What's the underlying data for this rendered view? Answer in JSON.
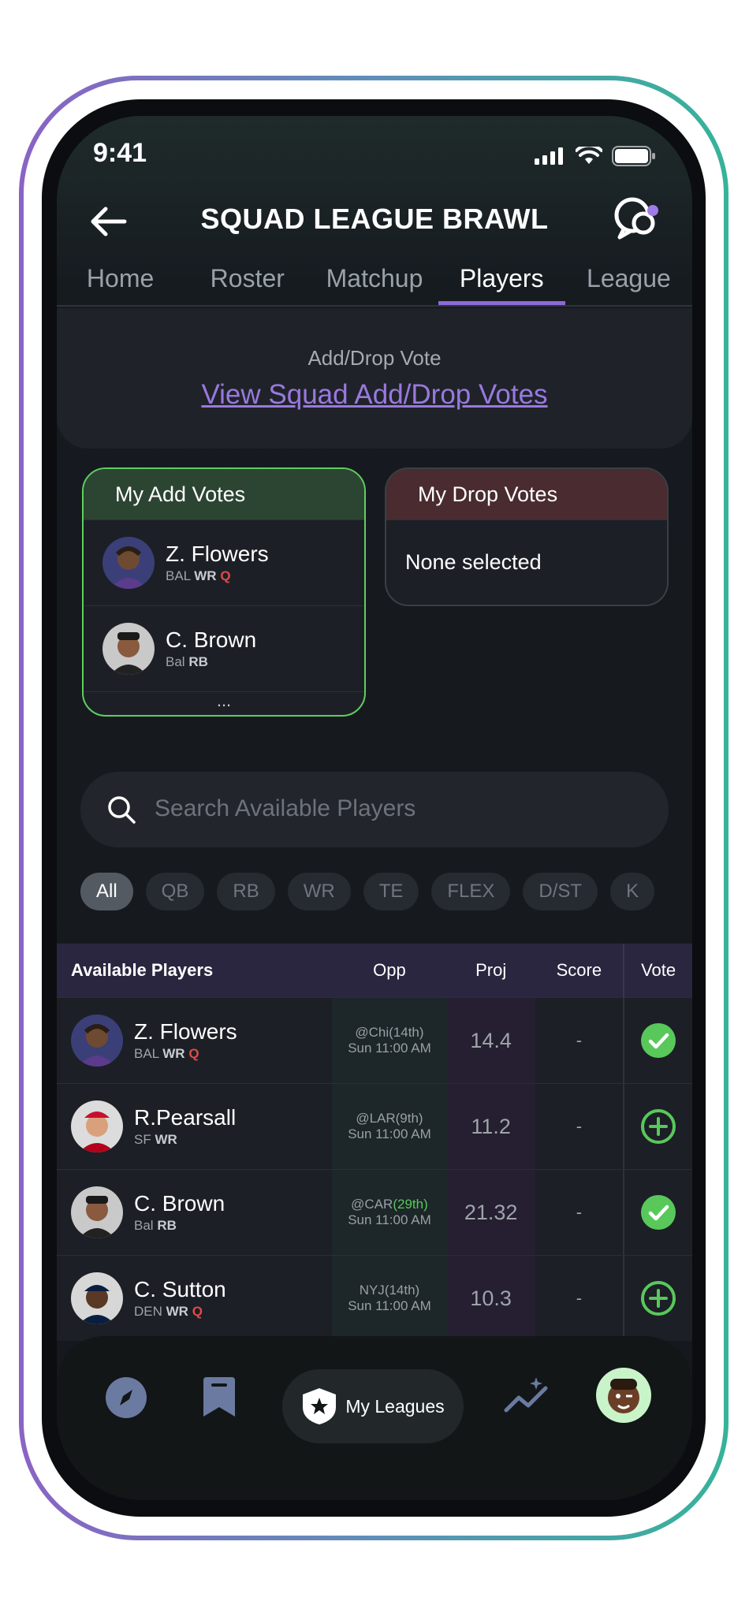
{
  "status": {
    "time": "9:41"
  },
  "header": {
    "title": "SQUAD LEAGUE BRAWL"
  },
  "tabs": [
    {
      "label": "Home"
    },
    {
      "label": "Roster"
    },
    {
      "label": "Matchup"
    },
    {
      "label": "Players"
    },
    {
      "label": "League"
    }
  ],
  "active_tab": "Players",
  "vote_banner": {
    "label": "Add/Drop Vote",
    "link": "View Squad Add/Drop Votes"
  },
  "add_votes": {
    "title": "My Add Votes",
    "players": [
      {
        "name": "Z. Flowers",
        "team": "BAL",
        "pos": "WR",
        "injury": "Q"
      },
      {
        "name": "C. Brown",
        "team": "Bal",
        "pos": "RB",
        "injury": ""
      }
    ],
    "more": "..."
  },
  "drop_votes": {
    "title": "My Drop Votes",
    "empty": "None selected"
  },
  "search": {
    "placeholder": "Search Available Players"
  },
  "filters": [
    "All",
    "QB",
    "RB",
    "WR",
    "TE",
    "FLEX",
    "D/ST",
    "K"
  ],
  "active_filter": "All",
  "table": {
    "headers": {
      "player": "Available Players",
      "opp": "Opp",
      "proj": "Proj",
      "score": "Score",
      "vote": "Vote"
    },
    "rows": [
      {
        "name": "Z. Flowers",
        "team": "BAL",
        "pos": "WR",
        "injury": "Q",
        "opp_team": "@Chi",
        "opp_rank": "(14th)",
        "opp_time": "Sun 11:00 AM",
        "proj": "14.4",
        "score": "-",
        "voted": true
      },
      {
        "name": "R.Pearsall",
        "team": "SF",
        "pos": "WR",
        "injury": "",
        "opp_team": "@LAR",
        "opp_rank": "(9th)",
        "opp_time": "Sun 11:00 AM",
        "proj": "11.2",
        "score": "-",
        "voted": false
      },
      {
        "name": "C. Brown",
        "team": "Bal",
        "pos": "RB",
        "injury": "",
        "opp_team": "@CAR",
        "opp_rank": "(29th)",
        "opp_time": "Sun 11:00 AM",
        "proj": "21.32",
        "score": "-",
        "voted": true
      },
      {
        "name": "C. Sutton",
        "team": "DEN",
        "pos": "WR",
        "injury": "Q",
        "opp_team": "NYJ",
        "opp_rank": "(14th)",
        "opp_time": "Sun 11:00 AM",
        "proj": "10.3",
        "score": "-",
        "voted": false
      }
    ]
  },
  "bottom_nav": {
    "leagues_label": "My Leagues"
  },
  "colors": {
    "accent": "#8b6ad6",
    "add": "#5fcf5e",
    "drop": "#4a2c30",
    "injury": "#e24a4a"
  }
}
